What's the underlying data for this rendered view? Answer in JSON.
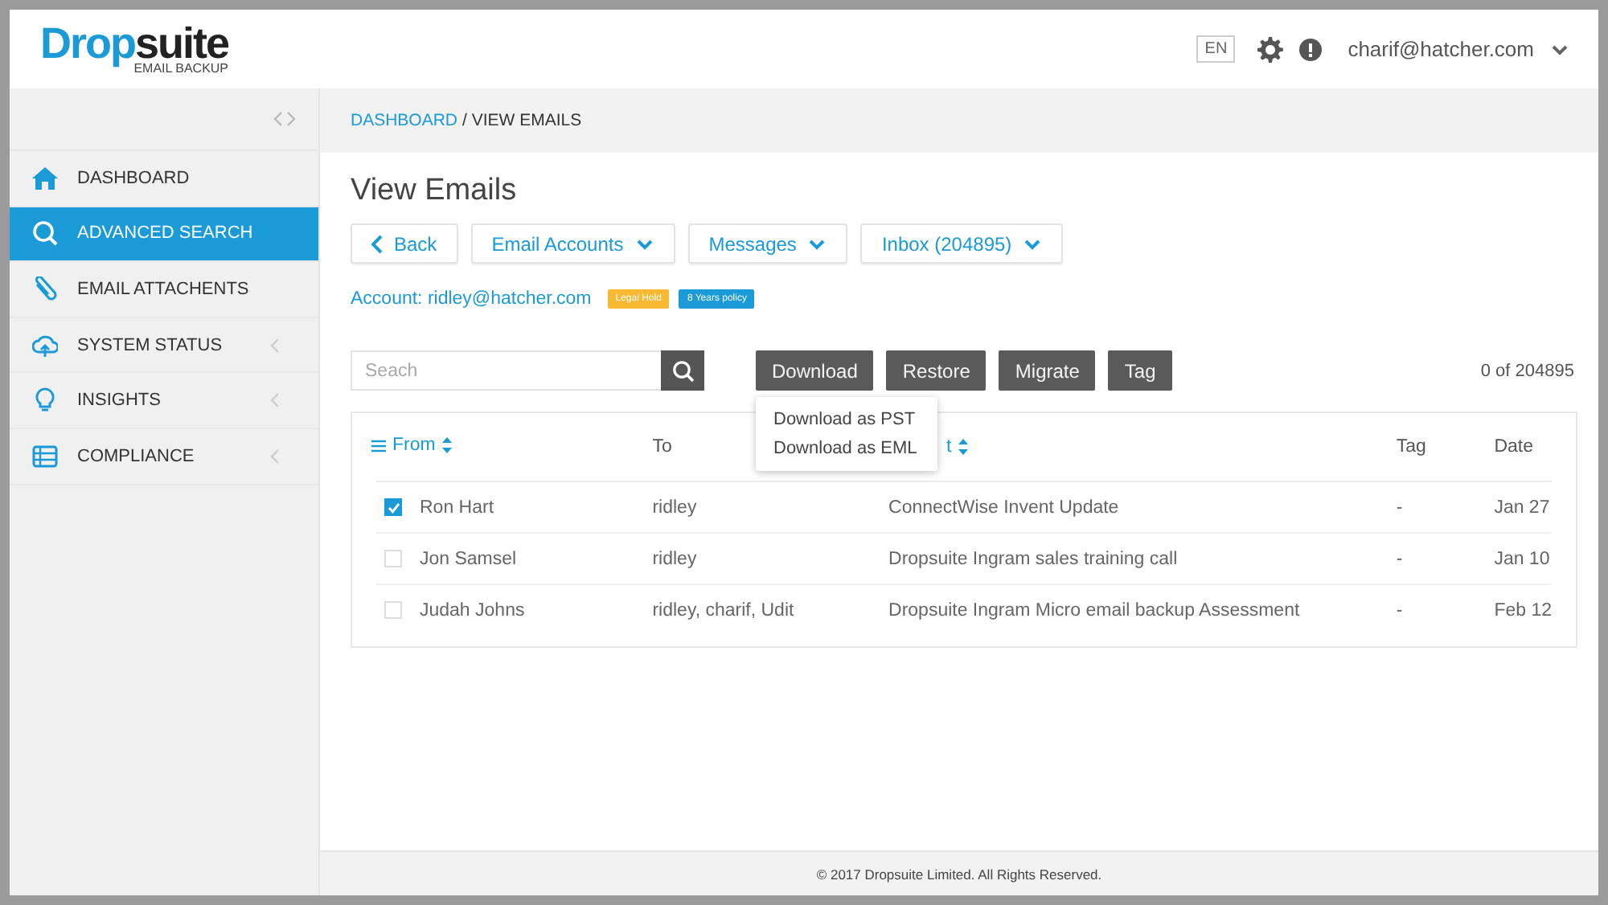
{
  "logo": {
    "text_1": "Drop",
    "text_2": "suite",
    "tagline": "EMAIL BACKUP"
  },
  "header": {
    "language": "EN",
    "user": "charif@hatcher.com"
  },
  "sidebar": {
    "items": [
      {
        "label": "DASHBOARD",
        "kind": "home",
        "selected": false,
        "expandable": false
      },
      {
        "label": "ADVANCED SEARCH",
        "kind": "search",
        "selected": true,
        "expandable": false
      },
      {
        "label": "EMAIL ATTACHENTS",
        "kind": "attachments",
        "selected": false,
        "expandable": false
      },
      {
        "label": "SYSTEM STATUS",
        "kind": "status",
        "selected": false,
        "expandable": true
      },
      {
        "label": "INSIGHTS",
        "kind": "insights",
        "selected": false,
        "expandable": true
      },
      {
        "label": "COMPLIANCE",
        "kind": "compliance",
        "selected": false,
        "expandable": true
      }
    ]
  },
  "breadcrumb": {
    "link": "DASHBOARD",
    "current": "/ VIEW EMAILS"
  },
  "title": "View Emails",
  "filters": [
    {
      "label": "Back",
      "kind": "back"
    },
    {
      "label": "Email Accounts",
      "kind": "dropdown"
    },
    {
      "label": "Messages",
      "kind": "dropdown"
    },
    {
      "label": "Inbox (204895)",
      "kind": "dropdown"
    }
  ],
  "account": {
    "label": "Account: ridley@hatcher.com",
    "badges": [
      {
        "label": "Legal Hold",
        "color": "#f6b931"
      },
      {
        "label": "8 Years policy",
        "color": "#1a9ad6"
      }
    ]
  },
  "search": {
    "placeholder": "Seach"
  },
  "actions": [
    "Download",
    "Restore",
    "Migrate",
    "Tag"
  ],
  "download_menu": [
    "Download as PST",
    "Download as EML"
  ],
  "count": "0 of 204895",
  "table": {
    "columns": [
      {
        "label": "From",
        "sortable": true,
        "kind": "menu"
      },
      {
        "label": "To",
        "sortable": false,
        "kind": "plain"
      },
      {
        "label": "t",
        "sortable": true,
        "kind": "covered"
      },
      {
        "label": "Tag",
        "sortable": false,
        "kind": "plain"
      },
      {
        "label": "Date",
        "sortable": false,
        "kind": "plain"
      }
    ],
    "rows": [
      {
        "from": "Ron Hart",
        "to": "ridley",
        "subject": "ConnectWise Invent Update",
        "tag": "-",
        "date": "Jan 27",
        "checked": true
      },
      {
        "from": "Jon Samsel",
        "to": "ridley",
        "subject": "Dropsuite Ingram sales training call",
        "tag": "-",
        "date": "Jan 10",
        "checked": false
      },
      {
        "from": "Judah Johns",
        "to": "ridley, charif, Udit",
        "subject": "Dropsuite Ingram Micro email backup Assessment",
        "tag": "-",
        "date": "Feb 12",
        "checked": false
      }
    ]
  },
  "footer": "© 2017 Dropsuite Limited. All Rights Reserved."
}
